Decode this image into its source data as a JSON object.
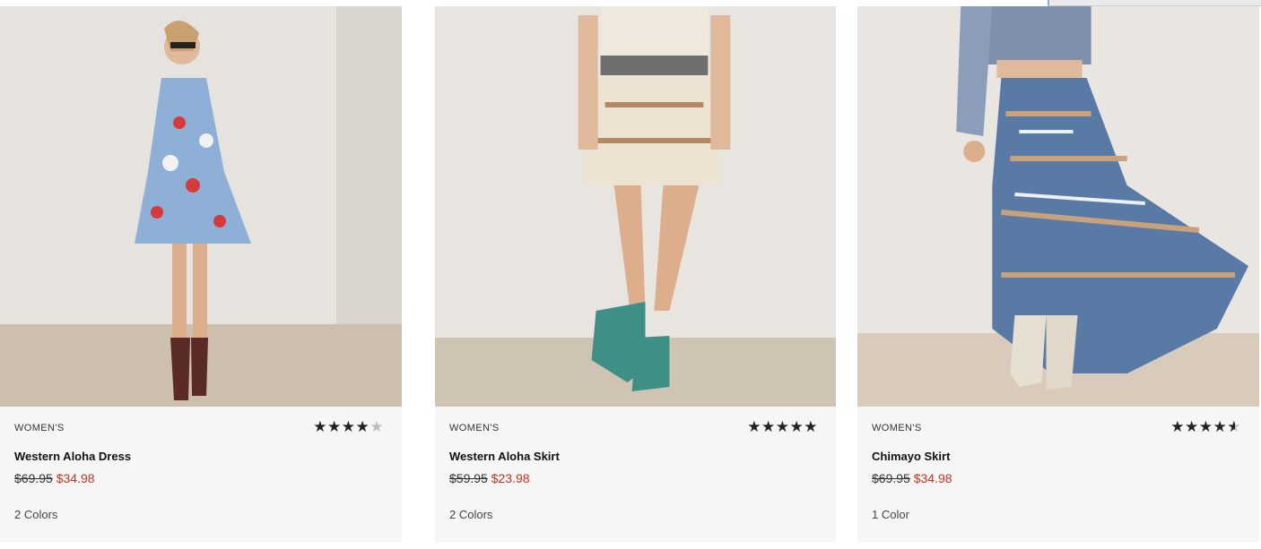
{
  "products": [
    {
      "category": "WOMEN'S",
      "name": "Western Aloha Skirt",
      "price_original": "$59.95",
      "price_sale": "$23.98",
      "colors": "2 Colors",
      "rating": 5,
      "image_icon": "product-photo-skirt"
    },
    {
      "category": "WOMEN'S",
      "name": "Chimayo Skirt",
      "price_original": "$69.95",
      "price_sale": "$34.98",
      "colors": "1 Color",
      "rating": 4.5,
      "image_icon": "product-photo-maxi-skirt"
    },
    {
      "category": "WOMEN'S",
      "name": "Western Aloha Dress",
      "price_original": "$69.95",
      "price_sale": "$34.98",
      "colors": "2 Colors",
      "rating": 4,
      "image_icon": "product-photo-dress"
    }
  ],
  "theme": {
    "sale_color": "#c8321e",
    "card_bg": "#f6f6f6",
    "star_filled": "#222222",
    "star_empty": "#bdbdbd"
  }
}
